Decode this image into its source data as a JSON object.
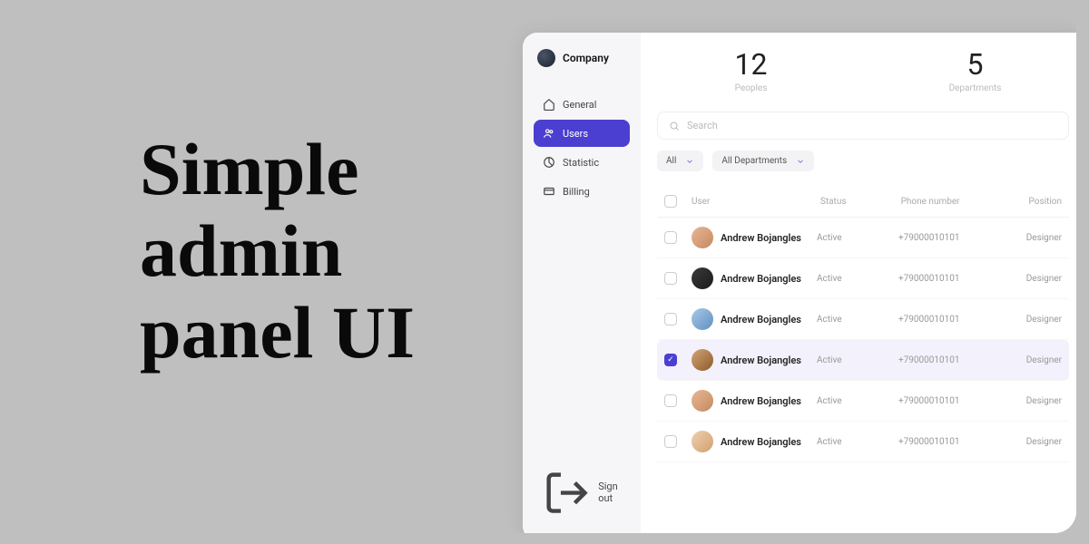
{
  "hero": "Simple\nadmin\npanel UI",
  "company": "Company",
  "nav": {
    "general": "General",
    "users": "Users",
    "statistic": "Statistic",
    "billing": "Billing",
    "signout": "Sign out"
  },
  "stats": {
    "peoples_val": "12",
    "peoples_lbl": "Peoples",
    "depts_val": "5",
    "depts_lbl": "Departments"
  },
  "search_placeholder": "Search",
  "filters": {
    "all": "All",
    "depts": "All Departments"
  },
  "cols": {
    "user": "User",
    "status": "Status",
    "phone": "Phone number",
    "position": "Position"
  },
  "rows": [
    {
      "name": "Andrew Bojangles",
      "status": "Active",
      "phone": "+79000010101",
      "position": "Designer",
      "selected": false,
      "av": "av1"
    },
    {
      "name": "Andrew Bojangles",
      "status": "Active",
      "phone": "+79000010101",
      "position": "Designer",
      "selected": false,
      "av": "av2"
    },
    {
      "name": "Andrew Bojangles",
      "status": "Active",
      "phone": "+79000010101",
      "position": "Designer",
      "selected": false,
      "av": "av3"
    },
    {
      "name": "Andrew Bojangles",
      "status": "Active",
      "phone": "+79000010101",
      "position": "Designer",
      "selected": true,
      "av": "av4"
    },
    {
      "name": "Andrew Bojangles",
      "status": "Active",
      "phone": "+79000010101",
      "position": "Designer",
      "selected": false,
      "av": "av5"
    },
    {
      "name": "Andrew Bojangles",
      "status": "Active",
      "phone": "+79000010101",
      "position": "Designer",
      "selected": false,
      "av": "av6"
    }
  ]
}
